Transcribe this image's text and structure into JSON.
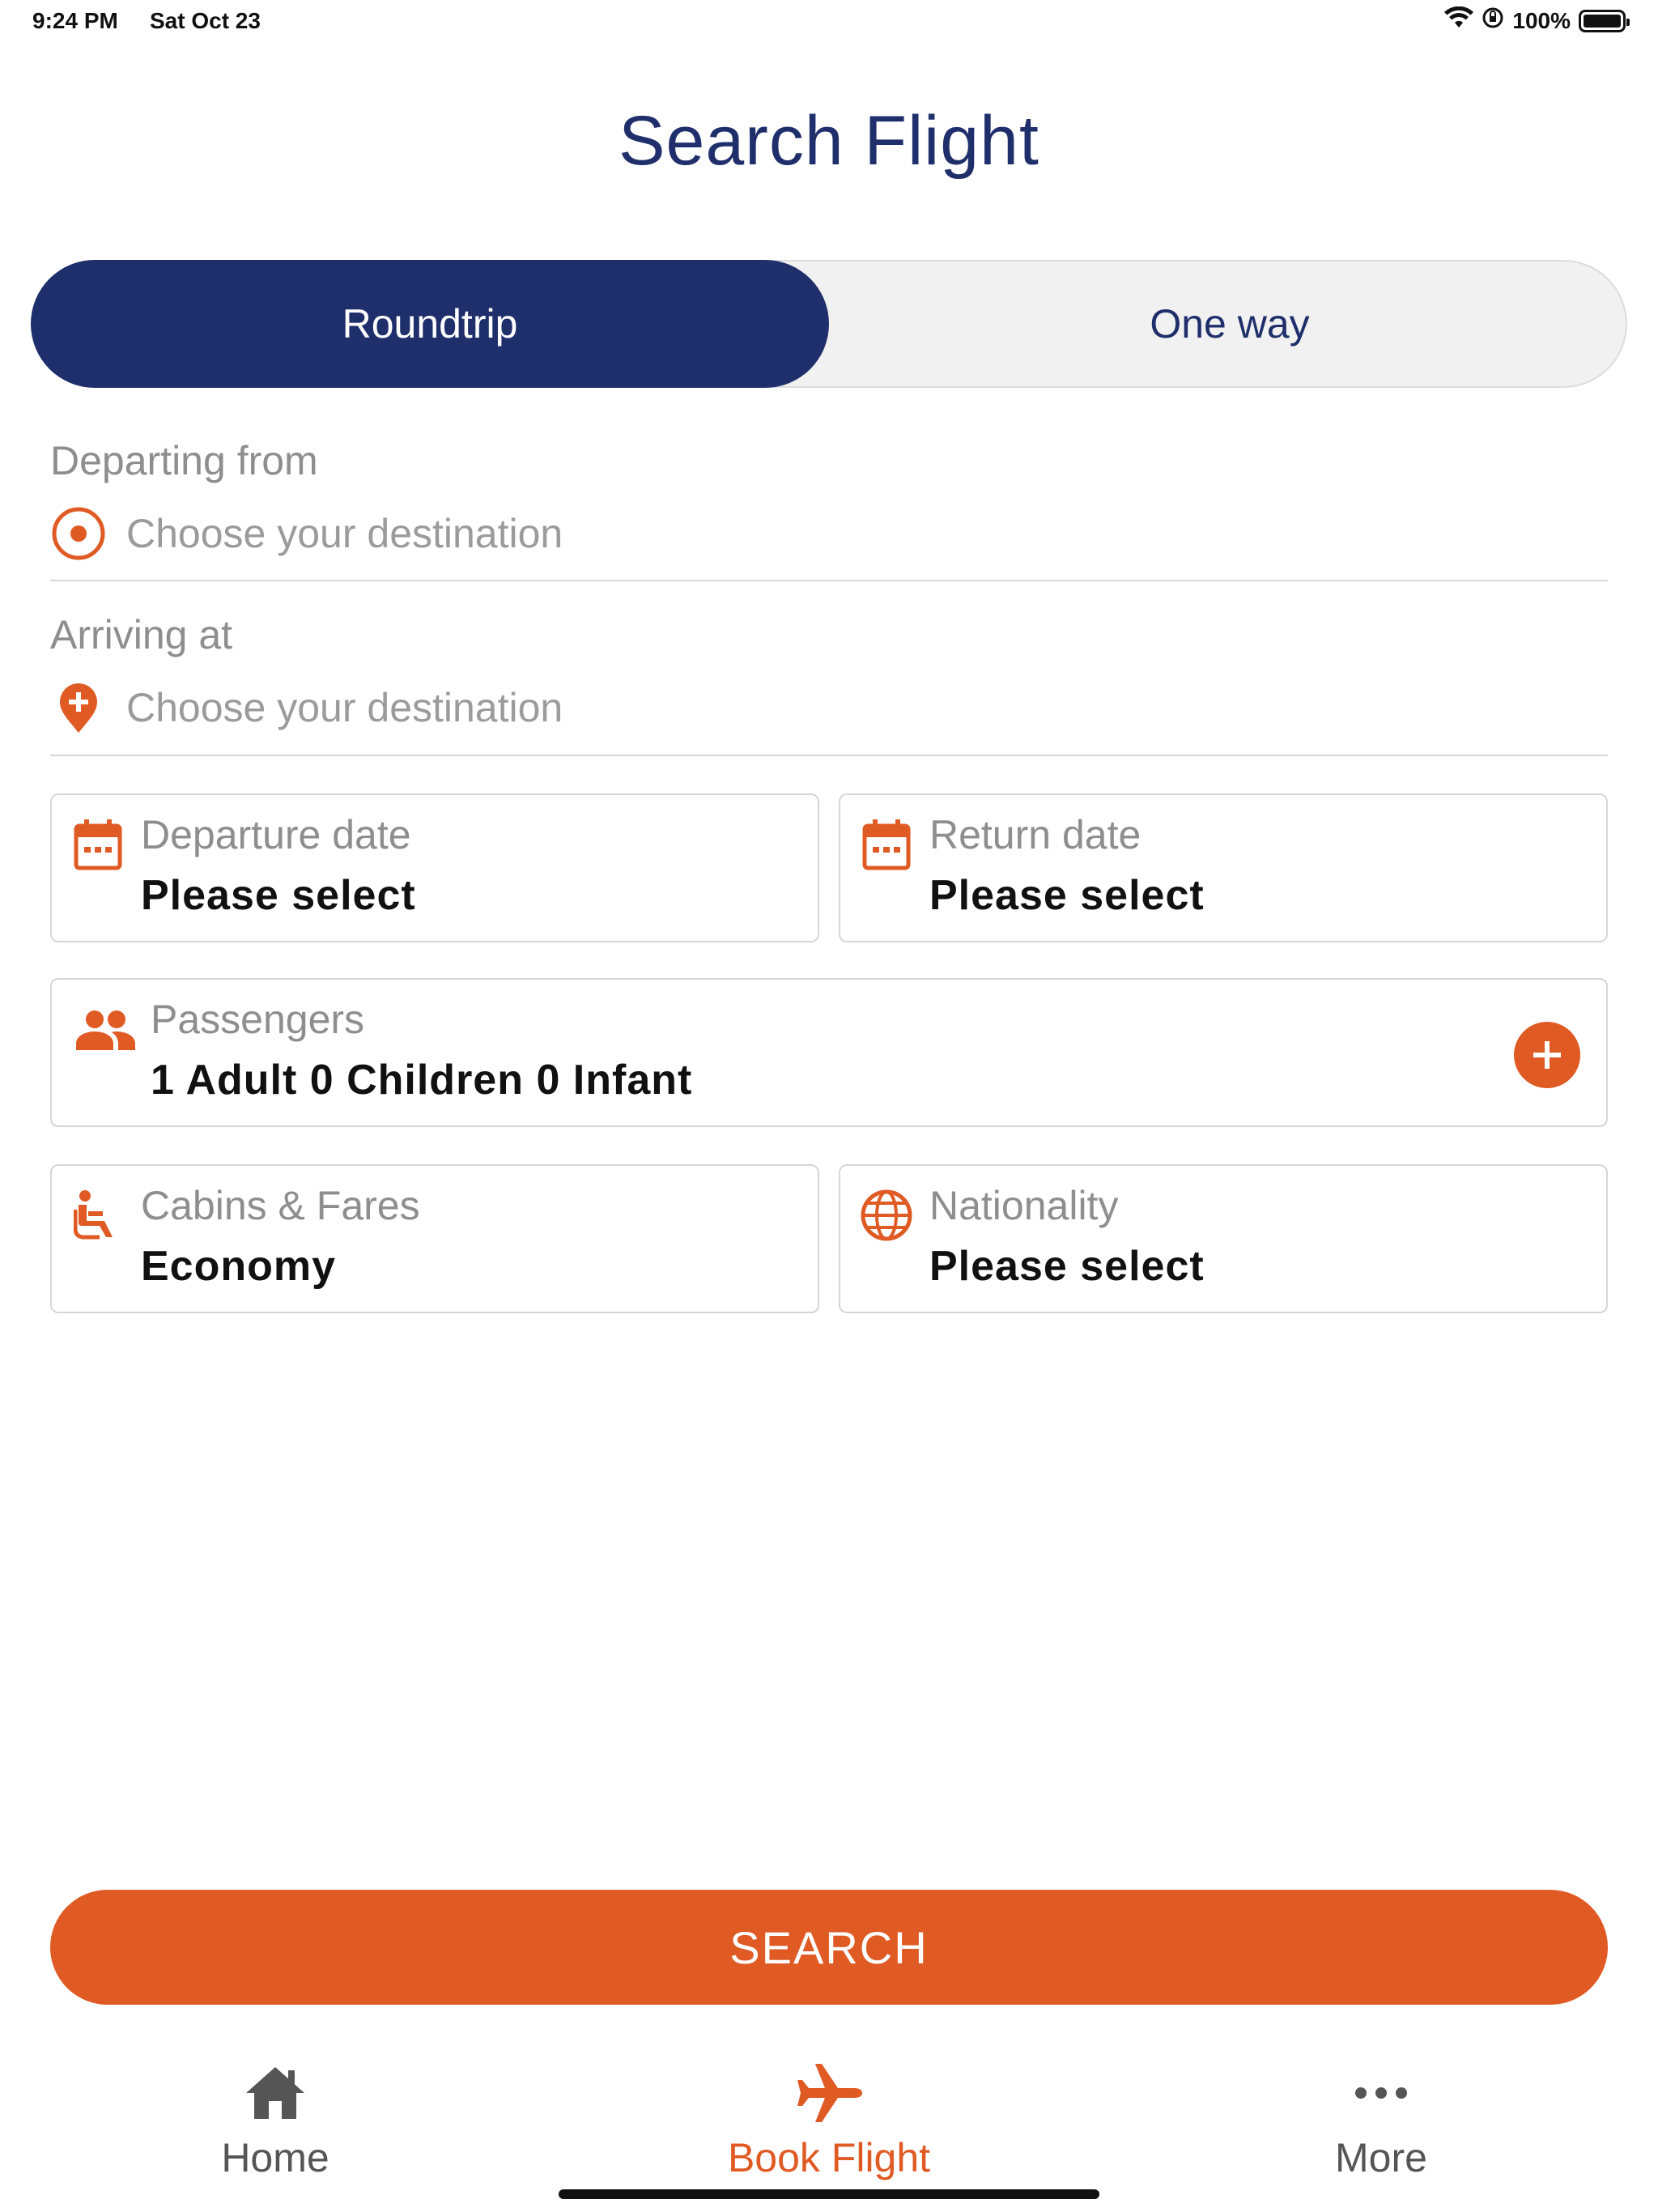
{
  "status_bar": {
    "time": "9:24 PM",
    "date": "Sat Oct 23",
    "battery": "100%"
  },
  "header": {
    "title": "Search Flight"
  },
  "trip_type": {
    "options": [
      "Roundtrip",
      "One way"
    ],
    "selected": "Roundtrip"
  },
  "departing": {
    "label": "Departing from",
    "placeholder": "Choose your destination"
  },
  "arriving": {
    "label": "Arriving at",
    "placeholder": "Choose your destination"
  },
  "departure_date": {
    "label": "Departure date",
    "value": "Please select"
  },
  "return_date": {
    "label": "Return date",
    "value": "Please select"
  },
  "passengers": {
    "label": "Passengers",
    "value": "1 Adult 0 Children 0 Infant"
  },
  "cabins": {
    "label": "Cabins & Fares",
    "value": "Economy"
  },
  "nationality": {
    "label": "Nationality",
    "value": "Please select"
  },
  "search_button": {
    "label": "SEARCH"
  },
  "tabbar": {
    "items": [
      {
        "label": "Home",
        "icon": "home-icon"
      },
      {
        "label": "Book Flight",
        "icon": "airplane-icon"
      },
      {
        "label": "More",
        "icon": "more-icon"
      }
    ],
    "active": "Book Flight"
  },
  "colors": {
    "navy": "#1f2f6b",
    "orange": "#e05a24",
    "gray_text": "#8e8e8e",
    "tab_inactive": "#555555"
  }
}
